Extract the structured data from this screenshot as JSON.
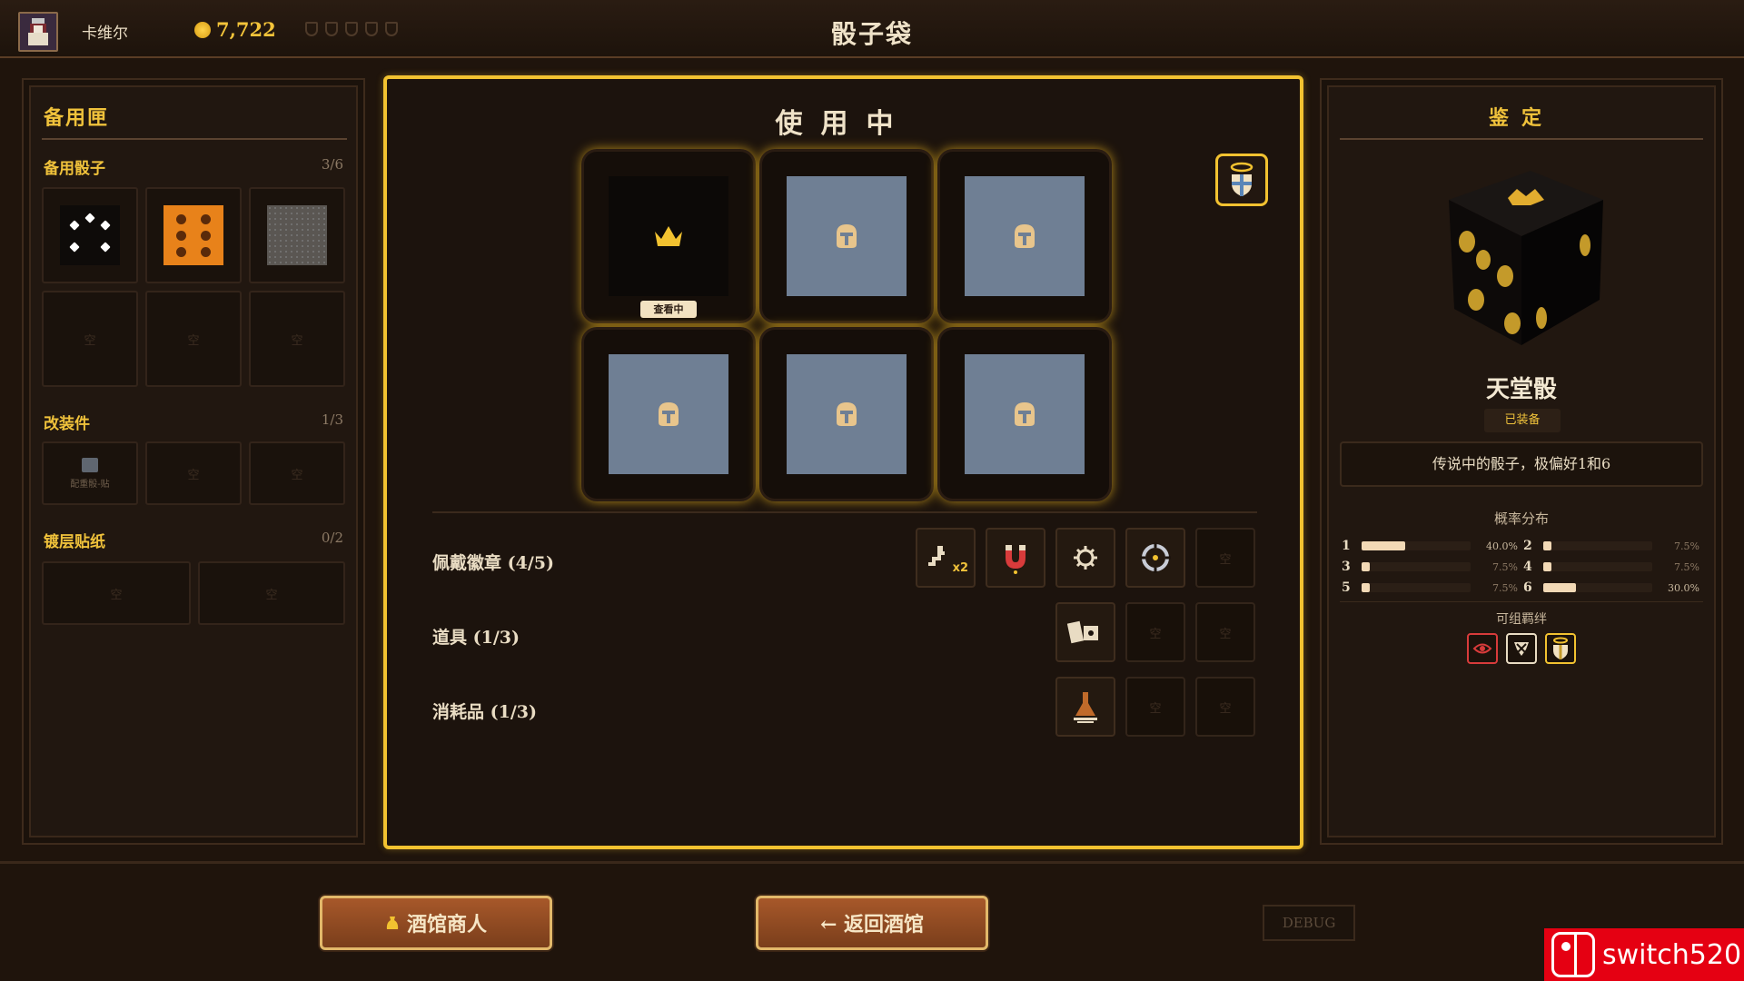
{
  "header": {
    "player_name": "卡维尔",
    "gold": "7,722",
    "title": "骰子袋"
  },
  "left_panel": {
    "title": "备用匣",
    "spare_dice": {
      "label": "备用骰子",
      "count": "3/6"
    },
    "mods": {
      "label": "改装件",
      "count": "1/3",
      "item_caption": "配重骰-贴"
    },
    "coatings": {
      "label": "镀层贴纸",
      "count": "0/2"
    },
    "empty_label": "空"
  },
  "center_panel": {
    "title": "使用中",
    "viewing_tag": "查看中",
    "rows": {
      "badges": "佩戴徽章 (4/5)",
      "tools": "道具 (1/3)",
      "consumables": "消耗品 (1/3)"
    },
    "badge_x2": "x2",
    "empty_label": "空"
  },
  "right_panel": {
    "title": "鉴定",
    "dice_name": "天堂骰",
    "equipped": "已装备",
    "description": "传说中的骰子，极偏好1和6",
    "prob_title": "概率分布",
    "probabilities": [
      {
        "face": "1",
        "pct": "40.0%",
        "value": 0.4
      },
      {
        "face": "2",
        "pct": "7.5%",
        "value": 0.075
      },
      {
        "face": "3",
        "pct": "7.5%",
        "value": 0.075
      },
      {
        "face": "4",
        "pct": "7.5%",
        "value": 0.075
      },
      {
        "face": "5",
        "pct": "7.5%",
        "value": 0.075
      },
      {
        "face": "6",
        "pct": "30.0%",
        "value": 0.3
      }
    ],
    "combo_title": "可组羁绊"
  },
  "bottom": {
    "merchant_button": "酒馆商人",
    "back_button": "← 返回酒馆",
    "debug_button": "DEBUG"
  },
  "watermark": {
    "text": "switch520"
  },
  "colors": {
    "gold_accent": "#f0c23b",
    "bag_face": "#6f7f94",
    "orange_die": "#e8821a",
    "panel_bg": "#211710"
  }
}
